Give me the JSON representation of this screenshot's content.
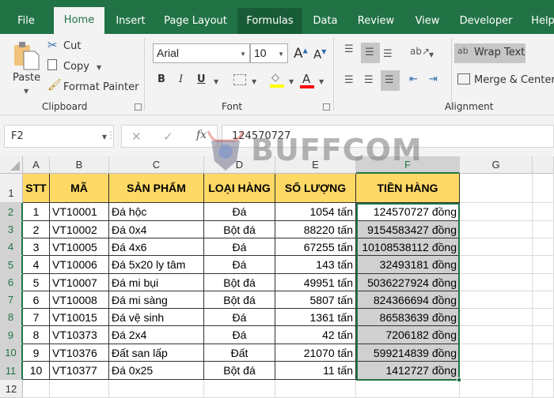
{
  "tabs": [
    {
      "label": "File",
      "active": false
    },
    {
      "label": "Home",
      "active": true
    },
    {
      "label": "Insert",
      "active": false
    },
    {
      "label": "Page Layout",
      "active": false
    },
    {
      "label": "Formulas",
      "active": false
    },
    {
      "label": "Data",
      "active": false
    },
    {
      "label": "Review",
      "active": false
    },
    {
      "label": "View",
      "active": false
    },
    {
      "label": "Developer",
      "active": false
    },
    {
      "label": "Help",
      "active": false
    }
  ],
  "ribbon": {
    "clipboard": {
      "paste": "Paste",
      "cut": "Cut",
      "copy": "Copy",
      "format_painter": "Format Painter",
      "group_label": "Clipboard"
    },
    "font": {
      "font_name": "Arial",
      "font_size": "10",
      "bold": "B",
      "italic": "I",
      "underline": "U",
      "group_label": "Font",
      "fill_color": "#ffff00",
      "font_color": "#ff0000"
    },
    "alignment": {
      "wrap_text": "Wrap Text",
      "merge_center": "Merge & Center",
      "group_label": "Alignment"
    }
  },
  "formula_bar": {
    "name_box": "F2",
    "fx": "fx",
    "value": "124570727"
  },
  "watermark": "BUFFCOM",
  "columns": [
    "A",
    "B",
    "C",
    "D",
    "E",
    "F",
    "G"
  ],
  "rows": [
    "1",
    "2",
    "3",
    "4",
    "5",
    "6",
    "7",
    "8",
    "9",
    "10",
    "11",
    "12"
  ],
  "table": {
    "headers": [
      "STT",
      "MÃ",
      "SẢN PHẨM",
      "LOẠI HÀNG",
      "SỐ LƯỢNG",
      "TIỀN HÀNG"
    ],
    "rows": [
      [
        "1",
        "VT10001",
        "Đá hộc",
        "Đá",
        "1054 tấn",
        "124570727 đồng"
      ],
      [
        "2",
        "VT10002",
        "Đá 0x4",
        "Bột đá",
        "88220 tấn",
        "9154583427 đồng"
      ],
      [
        "3",
        "VT10005",
        "Đá 4x6",
        "Đá",
        "67255 tấn",
        "10108538112 đồng"
      ],
      [
        "4",
        "VT10006",
        "Đá 5x20 ly tâm",
        "Đá",
        "143 tấn",
        "32493181 đồng"
      ],
      [
        "5",
        "VT10007",
        "Đá mi bụi",
        "Bột đá",
        "49951 tấn",
        "5036227924 đồng"
      ],
      [
        "6",
        "VT10008",
        "Đá mi sàng",
        "Bột đá",
        "5807 tấn",
        "824366694 đồng"
      ],
      [
        "7",
        "VT10015",
        "Đá vệ sinh",
        "Đá",
        "1361 tấn",
        "86583639 đồng"
      ],
      [
        "8",
        "VT10373",
        "Đá 2x4",
        "Đá",
        "42 tấn",
        "7206182 đồng"
      ],
      [
        "9",
        "VT10376",
        "Đất san lấp",
        "Đất",
        "21070 tấn",
        "599214839 đồng"
      ],
      [
        "10",
        "VT10377",
        "Đá 0x25",
        "Bột đá",
        "11 tấn",
        "1412727 đồng"
      ]
    ]
  },
  "selection": {
    "active_cell": "F2",
    "range": "F2:F11"
  },
  "colors": {
    "excel_green": "#217346",
    "header_fill": "#ffd966",
    "selection_gray": "#d0d0d0"
  }
}
